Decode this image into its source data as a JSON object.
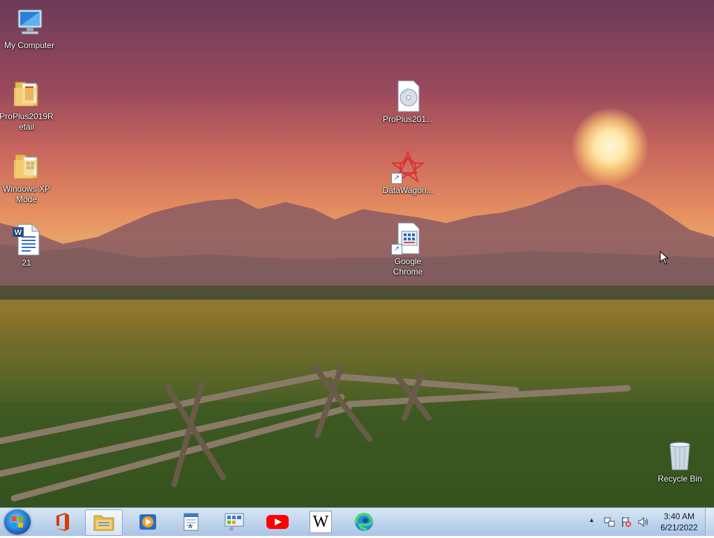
{
  "desktop": {
    "icons": [
      {
        "label": "My Computer",
        "icon": "computer-icon"
      },
      {
        "label": "ProPlus2019R\netail",
        "icon": "folder-icon"
      },
      {
        "label": "Windows XP\nMode",
        "icon": "folder-icon"
      },
      {
        "label": "21",
        "icon": "word-document-icon"
      },
      {
        "label": "ProPlus201...",
        "icon": "disc-image-icon"
      },
      {
        "label": "DataWagon...",
        "icon": "datawagon-icon"
      },
      {
        "label": "Google\nChrome",
        "icon": "chrome-shortcut-icon"
      },
      {
        "label": "Recycle Bin",
        "icon": "recycle-bin-icon"
      }
    ],
    "shortcut_arrow": "↗"
  },
  "taskbar": {
    "pinned": [
      {
        "name": "office-icon"
      },
      {
        "name": "file-explorer-icon"
      },
      {
        "name": "media-player-icon"
      },
      {
        "name": "wordpad-icon"
      },
      {
        "name": "control-panel-icon"
      },
      {
        "name": "youtube-icon"
      },
      {
        "name": "wikipedia-icon"
      },
      {
        "name": "edge-icon"
      }
    ],
    "wikipedia_letter": "W",
    "tray": {
      "arrow": "▲",
      "time": "3:40 AM",
      "date": "6/21/2022"
    }
  },
  "colors": {
    "taskbar_top": "#d8e6f4",
    "youtube_red": "#ff0000",
    "office_orange": "#d83b01"
  }
}
